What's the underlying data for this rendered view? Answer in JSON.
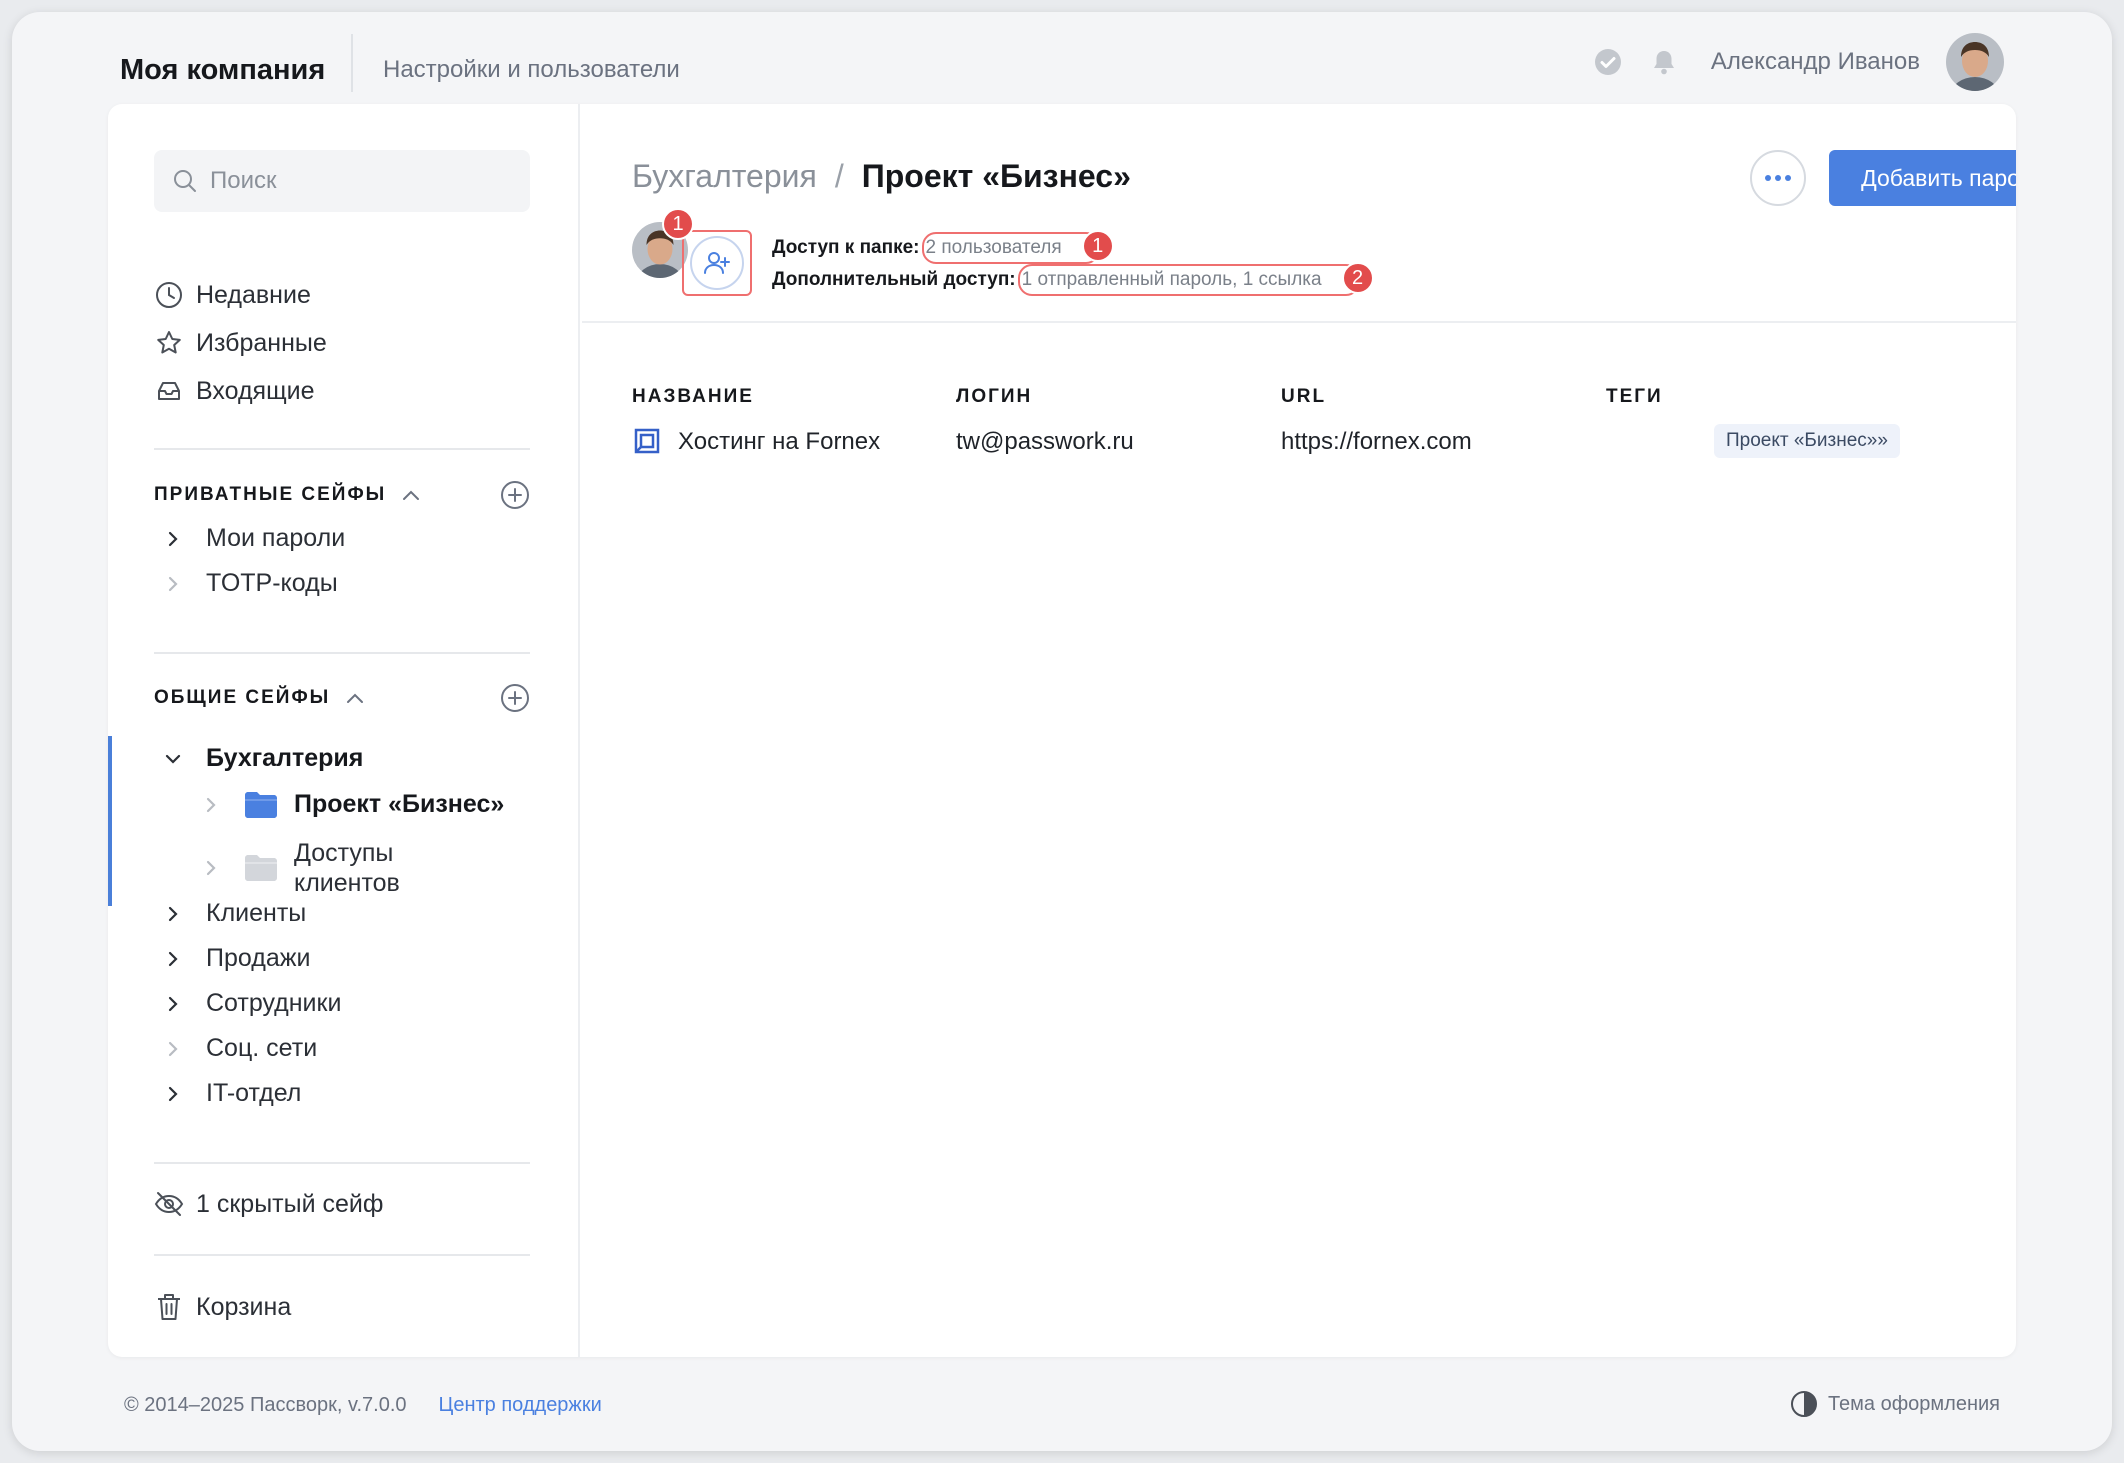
{
  "header": {
    "company": "Моя компания",
    "settings_link": "Настройки и пользователи",
    "user_name": "Александр Иванов"
  },
  "sidebar": {
    "search_placeholder": "Поиск",
    "quick": [
      {
        "label": "Недавние",
        "icon": "clock-icon"
      },
      {
        "label": "Избранные",
        "icon": "star-icon"
      },
      {
        "label": "Входящие",
        "icon": "inbox-icon"
      }
    ],
    "private_section": {
      "title": "ПРИВАТНЫЕ СЕЙФЫ",
      "items": [
        "Мои пароли",
        "TOTP-коды"
      ]
    },
    "shared_section": {
      "title": "ОБЩИЕ СЕЙФЫ",
      "active_vault": "Бухгалтерия",
      "subfolders": [
        "Проект «Бизнес»",
        "Доступы клиентов"
      ],
      "items": [
        "Клиенты",
        "Продажи",
        "Сотрудники",
        "Соц. сети",
        "IT-отдел"
      ]
    },
    "hidden_vaults": "1 скрытый сейф",
    "trash": "Корзина"
  },
  "content": {
    "breadcrumb_parent": "Бухгалтерия",
    "breadcrumb_sep": "/",
    "breadcrumb_current": "Проект «Бизнес»",
    "add_password_label": "Добавить пароль",
    "access_label": "Доступ к папке:",
    "access_value": "2 пользователя",
    "extra_access_label": "Дополнительный доступ:",
    "extra_access_value": "1 отправленный пароль, 1 ссылка",
    "badges": [
      "1",
      "1",
      "2"
    ],
    "columns": [
      "НАЗВАНИЕ",
      "ЛОГИН",
      "URL",
      "ТЕГИ"
    ],
    "rows": [
      {
        "name": "Хостинг на Fornex",
        "login": "tw@passwork.ru",
        "url": "https://fornex.com",
        "tag": "Проект «Бизнес»»"
      }
    ]
  },
  "footer": {
    "copyright": "© 2014–2025 Пассворк, v.7.0.0",
    "support": "Центр поддержки",
    "theme": "Тема оформления"
  },
  "colors": {
    "accent": "#4a80e0",
    "highlight": "#ef6f6f",
    "badge": "#e24c4c"
  }
}
